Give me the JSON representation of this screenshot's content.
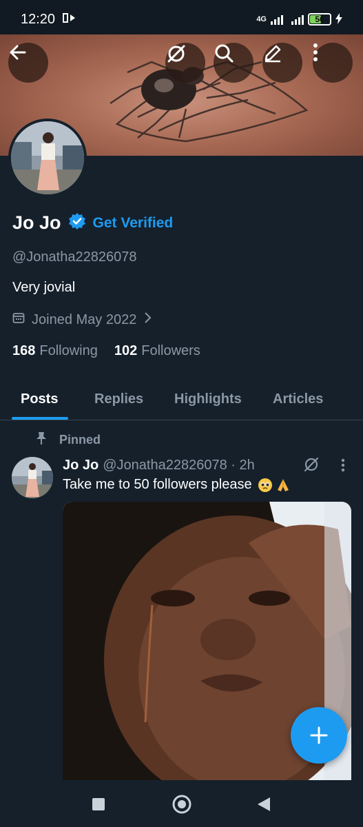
{
  "status_bar": {
    "time": "12:20",
    "network": "4G",
    "battery": "56",
    "battery_level": 0.56
  },
  "header": {
    "back_icon": "arrow-left-icon",
    "grok_icon": "grok-icon",
    "search_icon": "search-icon",
    "edit_icon": "pencil-icon",
    "more_icon": "more-vertical-icon"
  },
  "profile": {
    "name": "Jo Jo",
    "get_verified": "Get Verified",
    "handle": "@Jonatha22826078",
    "bio": "Very jovial",
    "joined": "Joined May 2022",
    "following_count": "168",
    "following_label": "Following",
    "followers_count": "102",
    "followers_label": "Followers"
  },
  "tabs": [
    {
      "label": "Posts",
      "active": true
    },
    {
      "label": "Replies",
      "active": false
    },
    {
      "label": "Highlights",
      "active": false
    },
    {
      "label": "Articles",
      "active": false
    }
  ],
  "post": {
    "pinned_label": "Pinned",
    "author_name": "Jo Jo",
    "author_handle": "@Jonatha22826078 · 2h",
    "text": "Take me to 50 followers please",
    "emojis": [
      "pleading-face-emoji",
      "folded-hands-emoji"
    ]
  },
  "colors": {
    "accent": "#1d9bf0",
    "background": "#15202b",
    "muted_text": "#8b98a5"
  },
  "nav": {
    "recents_icon": "square-icon",
    "home_icon": "circle-icon",
    "back_icon": "triangle-back-icon"
  }
}
